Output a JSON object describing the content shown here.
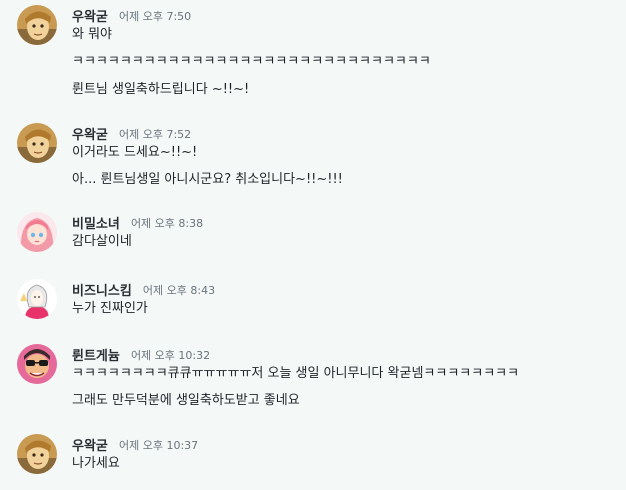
{
  "messages": [
    {
      "user": "우왁굳",
      "time": "어제 오후 7:50",
      "avatar": "woowakgood-avatar",
      "lines": [
        "와 뭐야",
        "ㅋㅋㅋㅋㅋㅋㅋㅋㅋㅋㅋㅋㅋㅋㅋㅋㅋㅋㅋㅋㅋㅋㅋㅋㅋㅋㅋㅋㅋㅋ",
        "륀트님 생일축하드립니다 ~!!~!"
      ]
    },
    {
      "user": "우왁굳",
      "time": "어제 오후 7:52",
      "avatar": "woowakgood-avatar",
      "lines": [
        "이거라도 드세요~!!~!",
        "아... 륀트님생일 아니시군요? 취소입니다~!!~!!!"
      ]
    },
    {
      "user": "비밀소녀",
      "time": "어제 오후 8:38",
      "avatar": "pink-hair-girl-avatar",
      "lines": [
        "감다살이네"
      ]
    },
    {
      "user": "비즈니스킴",
      "time": "어제 오후 8:43",
      "avatar": "business-kim-avatar",
      "lines": [
        "누가 진짜인가"
      ]
    },
    {
      "user": "륀트게늄",
      "time": "어제 오후 10:32",
      "avatar": "sunglasses-avatar",
      "lines": [
        "ㅋㅋㅋㅋㅋㅋㅋㅋ큐큐ㅠㅠㅠㅠㅠ저 오늘 생일 아니무니다 왁굳넴ㅋㅋㅋㅋㅋㅋㅋㅋ",
        "그래도 만두덕분에 생일축하도받고 좋네요"
      ]
    },
    {
      "user": "우왁굳",
      "time": "어제 오후 10:37",
      "avatar": "woowakgood-avatar",
      "lines": [
        "나가세요"
      ]
    }
  ],
  "colors": {
    "background": "#f4f9f7",
    "text": "#1f2329",
    "timestamp": "#6a737d"
  }
}
